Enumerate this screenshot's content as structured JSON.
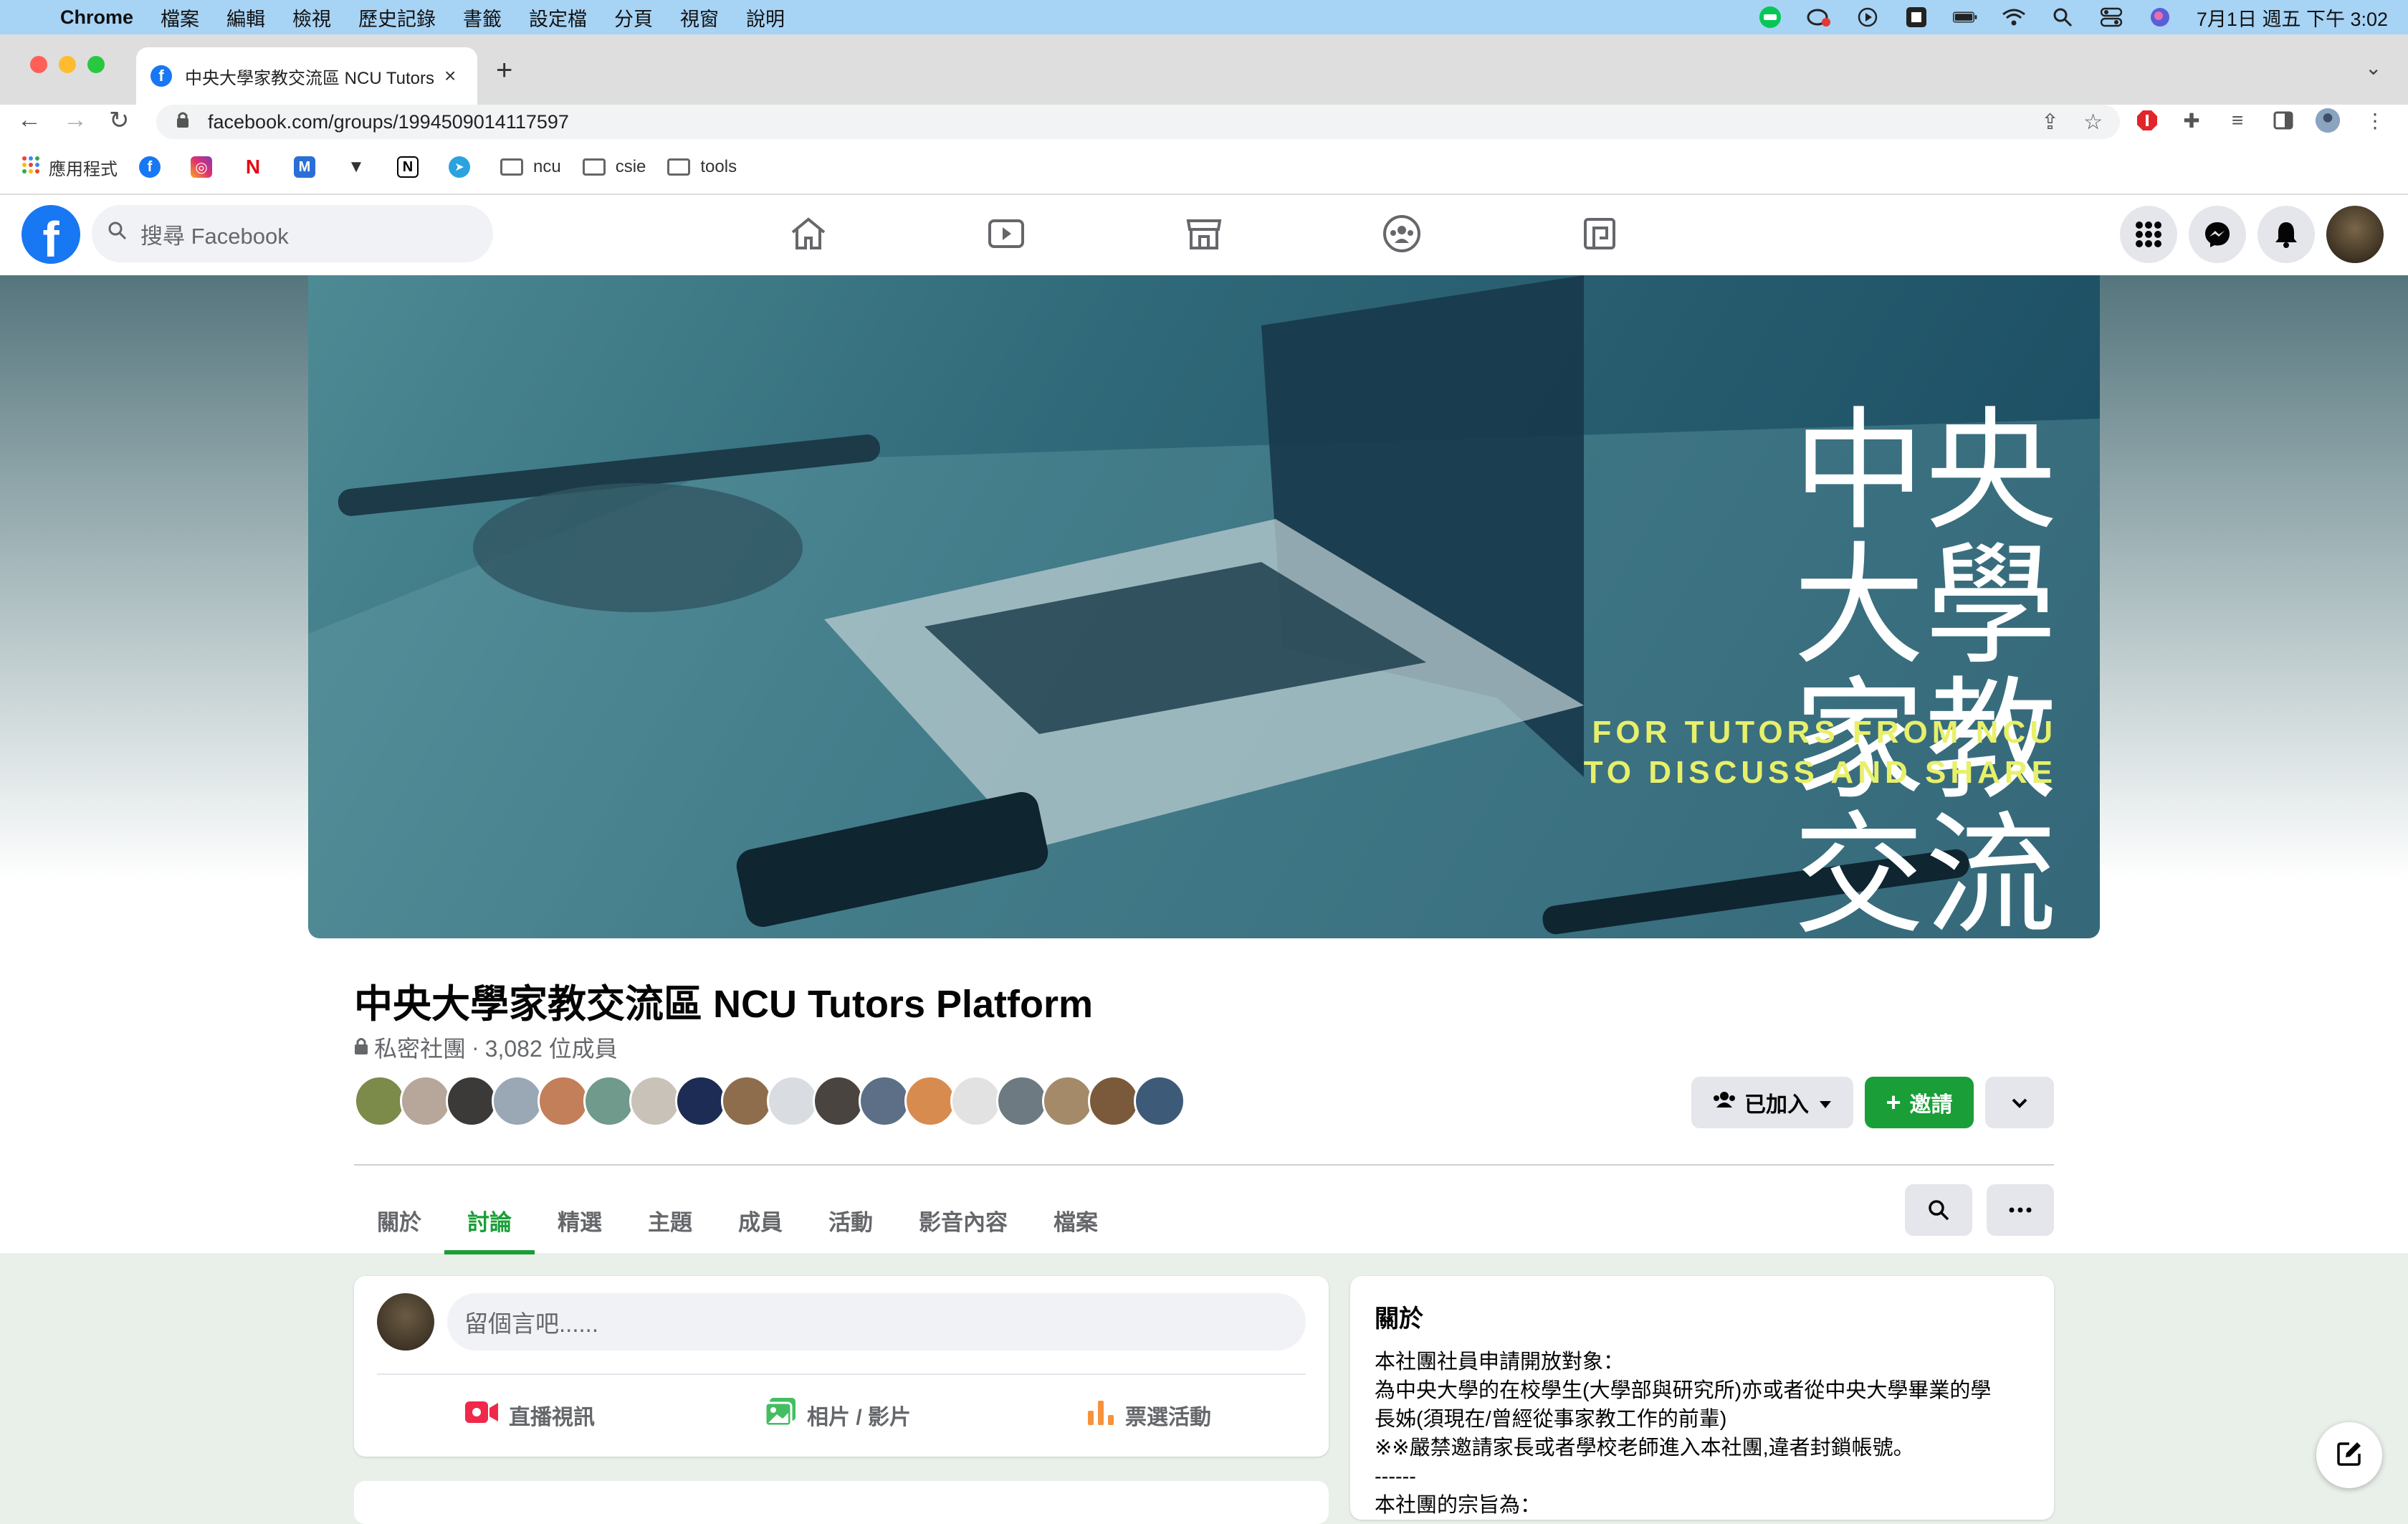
{
  "menubar": {
    "app_name": "Chrome",
    "items": [
      "檔案",
      "編輯",
      "檢視",
      "歷史記錄",
      "書籤",
      "設定檔",
      "分頁",
      "視窗",
      "說明"
    ],
    "clock": "7月1日 週五 下午 3:02"
  },
  "browser": {
    "tab_title": "中央大學家教交流區 NCU Tutors Platform",
    "url": "facebook.com/groups/1994509014117597",
    "bookmarks": {
      "apps_label": "應用程式",
      "folders": [
        "ncu",
        "csie",
        "tools"
      ]
    }
  },
  "fb": {
    "search_placeholder": "搜尋 Facebook",
    "logo": "f"
  },
  "cover": {
    "title_line1": "中央大學",
    "title_line2": "家教交流社",
    "subtitle_line1": "FOR TUTORS FROM NCU",
    "subtitle_line2": "TO DISCUSS AND SHARE"
  },
  "group": {
    "name": "中央大學家教交流區 NCU Tutors Platform",
    "privacy": "私密社團",
    "separator": "·",
    "members": "3,082 位成員",
    "joined_label": "已加入",
    "invite_label": "邀請"
  },
  "tabs": [
    "關於",
    "討論",
    "精選",
    "主題",
    "成員",
    "活動",
    "影音內容",
    "檔案"
  ],
  "composer": {
    "placeholder": "留個言吧......",
    "live_label": "直播視訊",
    "photo_label": "相片 / 影片",
    "poll_label": "票選活動"
  },
  "about": {
    "title": "關於",
    "lines": [
      "本社團社員申請開放對象：",
      "為中央大學的在校學生(大學部與研究所)亦或者從中央大學畢業的學",
      "長姊(須現在/曾經從事家教工作的前輩)",
      "※※嚴禁邀請家長或者學校老師進入本社團,違者封鎖帳號。",
      "------",
      "本社團的宗旨為："
    ]
  },
  "colors": {
    "accent_green": "#1a9e38",
    "fb_blue": "#1877f2",
    "menubar": "#a7d3f5"
  }
}
